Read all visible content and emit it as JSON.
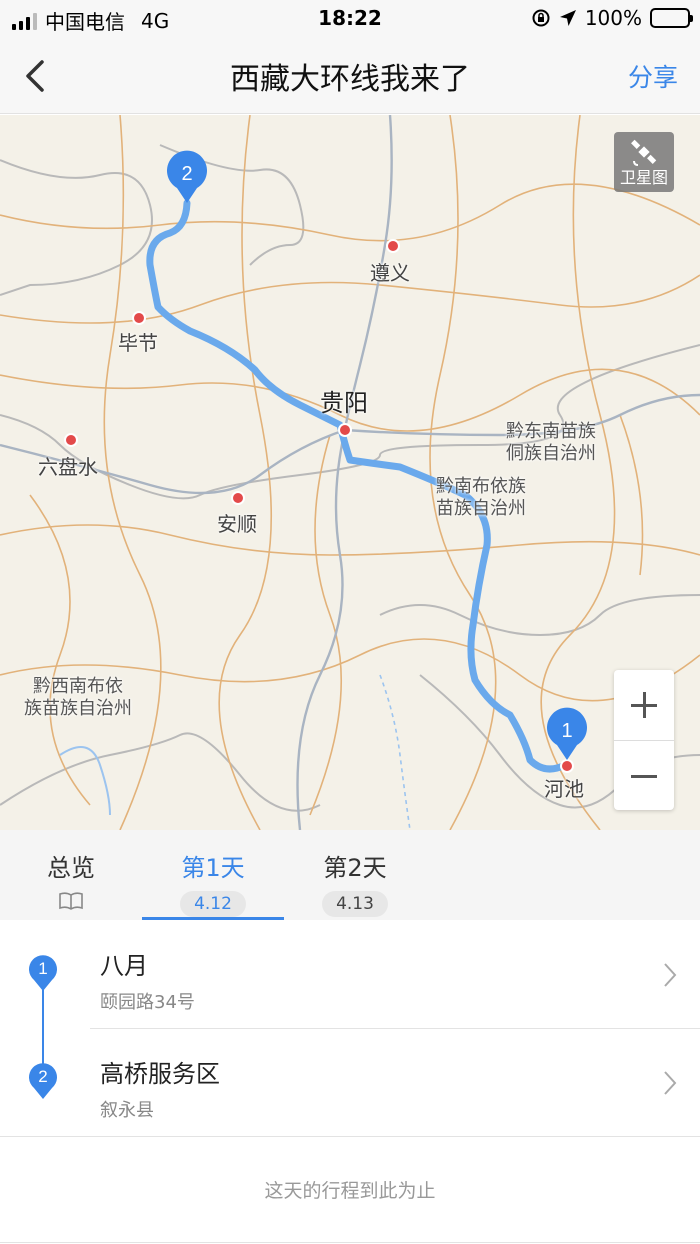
{
  "status_bar": {
    "carrier": "中国电信",
    "network": "4G",
    "time": "18:22",
    "battery": "100%"
  },
  "nav": {
    "title": "西藏大环线我来了",
    "share_label": "分享"
  },
  "map": {
    "satellite_label": "卫星图",
    "cities": {
      "zunyi": "遵义",
      "bijie": "毕节",
      "guiyang": "贵阳",
      "liupanshui": "六盘水",
      "anshun": "安顺",
      "hechi": "河池"
    },
    "regions": {
      "qiandongnan_1": "黔东南苗族",
      "qiandongnan_2": "侗族自治州",
      "qiannan_1": "黔南布依族",
      "qiannan_2": "苗族自治州",
      "qianxinan_1": "黔西南布依",
      "qianxinan_2": "族苗族自治州"
    },
    "markers": {
      "start": "1",
      "end": "2"
    },
    "route_color": "#6aa9ec"
  },
  "tabs": [
    {
      "label": "总览",
      "sub": ""
    },
    {
      "label": "第1天",
      "sub": "4.12"
    },
    {
      "label": "第2天",
      "sub": "4.13"
    }
  ],
  "stops": [
    {
      "index": "1",
      "title": "八月",
      "address": "颐园路34号"
    },
    {
      "index": "2",
      "title": "高桥服务区",
      "address": "叙永县"
    }
  ],
  "end_note": "这天的行程到此为止",
  "accent_color": "#3a86e8"
}
